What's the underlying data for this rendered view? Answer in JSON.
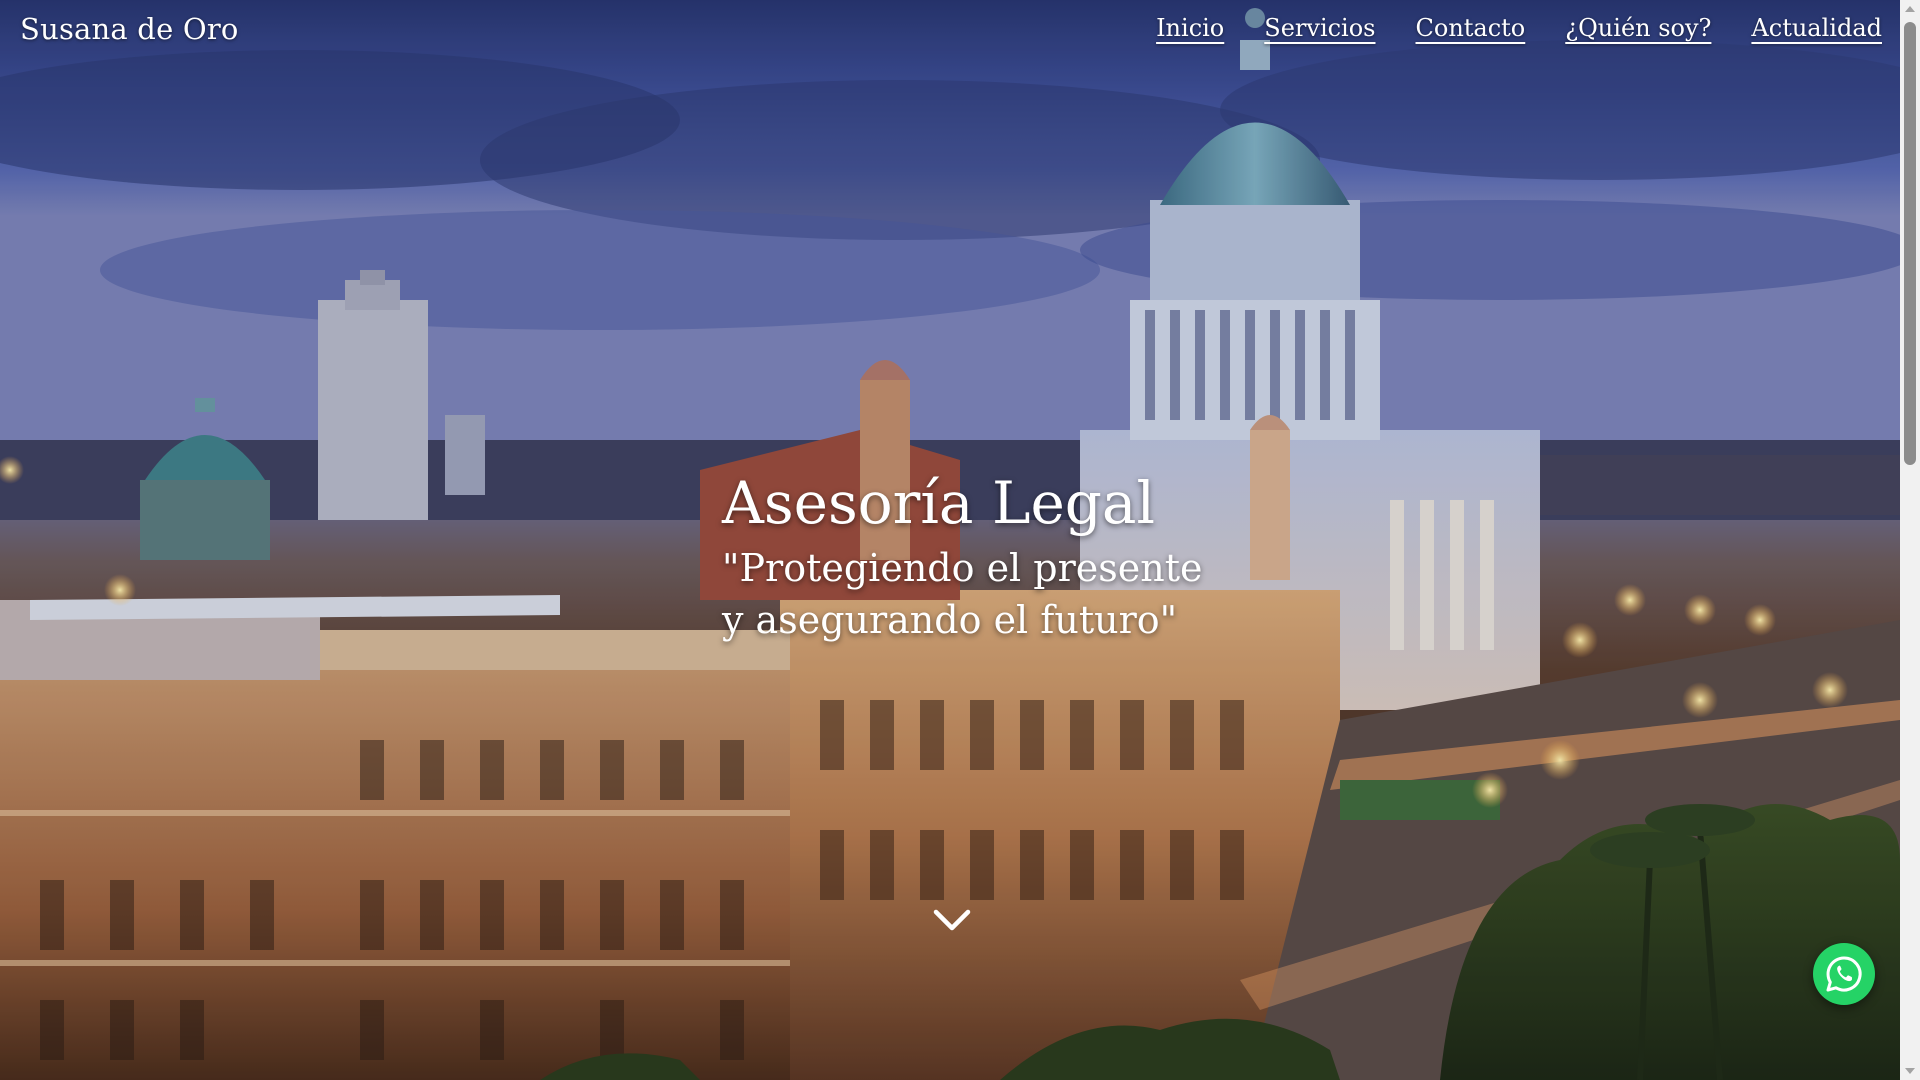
{
  "site": {
    "brand": "Susana de Oro"
  },
  "nav": {
    "items": [
      {
        "label": "Inicio"
      },
      {
        "label": "Servicios"
      },
      {
        "label": "Contacto"
      },
      {
        "label": "¿Quién soy?"
      },
      {
        "label": "Actualidad"
      }
    ]
  },
  "hero": {
    "title": "Asesoría Legal",
    "subtitle_line1": "\"Protegiendo el presente",
    "subtitle_line2": "y asegurando el futuro\"",
    "background_image": "havana-capitol-dusk-cityscape"
  },
  "icons": {
    "scroll": "chevron-down-icon",
    "whatsapp": "whatsapp-icon"
  },
  "colors": {
    "text": "#ffffff",
    "whatsapp": "#25d366",
    "sky": "#4a5ba6",
    "city_lights": "#e0a860"
  }
}
